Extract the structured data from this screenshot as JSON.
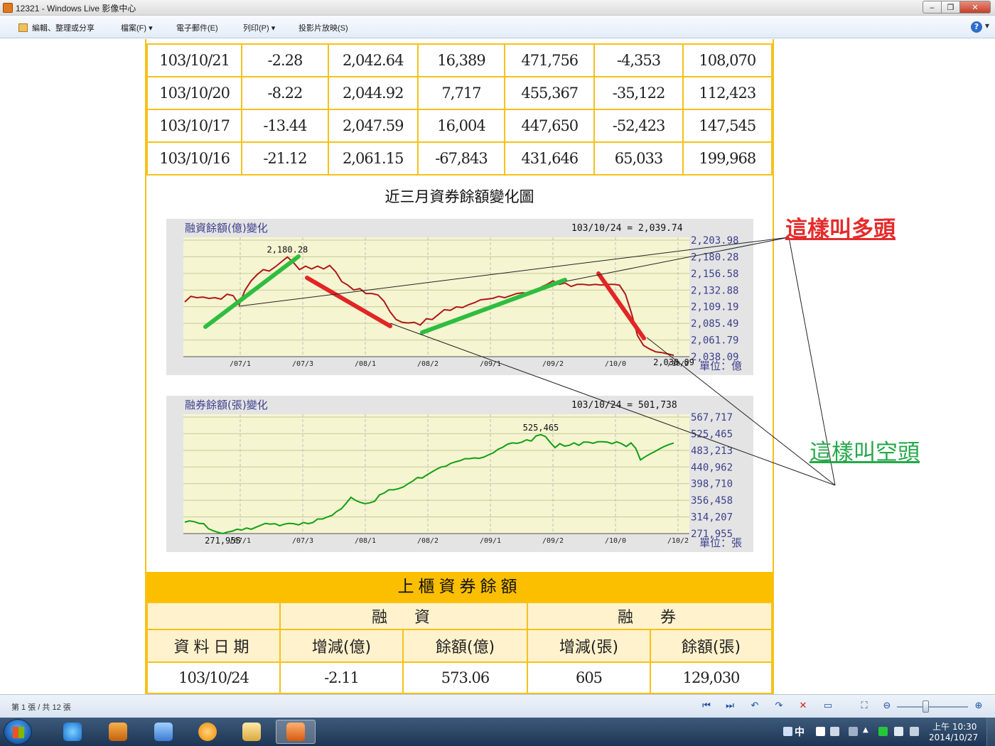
{
  "window": {
    "title": "12321 - Windows Live 影像中心",
    "buttons": {
      "minimize": "‒",
      "maximize": "❐",
      "close": "✕"
    }
  },
  "menu": {
    "edit": "編輯、整理或分享",
    "file": "檔案(F) ▾",
    "email": "電子郵件(E)",
    "print": "列印(P) ▾",
    "slideshow": "投影片放映(S)",
    "help": "?"
  },
  "top_table": {
    "rows": [
      [
        "103/10/21",
        "-2.28",
        "2,042.64",
        "16,389",
        "471,756",
        "-4,353",
        "108,070"
      ],
      [
        "103/10/20",
        "-8.22",
        "2,044.92",
        "7,717",
        "455,367",
        "-35,122",
        "112,423"
      ],
      [
        "103/10/17",
        "-13.44",
        "2,047.59",
        "16,004",
        "447,650",
        "-52,423",
        "147,545"
      ],
      [
        "103/10/16",
        "-21.12",
        "2,061.15",
        "-67,843",
        "431,646",
        "65,033",
        "199,968"
      ]
    ]
  },
  "section_title": "近三月資券餘額變化圖",
  "chart_data": [
    {
      "type": "line",
      "title": "融資餘額(億)變化",
      "latest": "103/10/24 = 2,039.74",
      "unit": "單位：億",
      "x_ticks": [
        "/07/1",
        "/07/3",
        "/08/1",
        "/08/2",
        "/09/1",
        "/09/2",
        "/10/0",
        "/10/2"
      ],
      "y_ticks": [
        "2,203.98",
        "2,180.28",
        "2,156.58",
        "2,132.88",
        "2,109.19",
        "2,085.49",
        "2,061.79",
        "2,038.09"
      ],
      "ylim": [
        2038.09,
        2203.98
      ],
      "max_label": "2,180.28",
      "min_label": "2,038.09",
      "line_color": "#b01818",
      "values": [
        2116,
        2124,
        2122,
        2123,
        2121,
        2122,
        2120,
        2127,
        2125,
        2112,
        2133,
        2146,
        2155,
        2162,
        2160,
        2166,
        2173,
        2180,
        2172,
        2162,
        2167,
        2163,
        2167,
        2163,
        2168,
        2159,
        2145,
        2140,
        2133,
        2135,
        2128,
        2128,
        2126,
        2117,
        2102,
        2091,
        2087,
        2086,
        2087,
        2083,
        2092,
        2091,
        2098,
        2105,
        2104,
        2109,
        2108,
        2112,
        2115,
        2119,
        2120,
        2121,
        2124,
        2122,
        2125,
        2128,
        2129,
        2128,
        2130,
        2137,
        2141,
        2146,
        2141,
        2143,
        2138,
        2141,
        2141,
        2140,
        2141,
        2140,
        2141,
        2141,
        2140,
        2127,
        2100,
        2068,
        2054,
        2049,
        2045,
        2044,
        2042,
        2040
      ]
    },
    {
      "type": "line",
      "title": "融券餘額(張)變化",
      "latest": "103/10/24 = 501,738",
      "unit": "單位：張",
      "x_ticks": [
        "/07/1",
        "/07/3",
        "/08/1",
        "/08/2",
        "/09/1",
        "/09/2",
        "/10/0",
        "/10/2"
      ],
      "y_ticks": [
        "567,717",
        "525,465",
        "483,213",
        "440,962",
        "398,710",
        "356,458",
        "314,207",
        "271,955"
      ],
      "ylim": [
        271955,
        567717
      ],
      "max_label": "525,465",
      "min_label": "271,955",
      "line_color": "#12a012",
      "values": [
        301000,
        304000,
        302000,
        298000,
        297000,
        284000,
        279000,
        275000,
        272000,
        276000,
        278000,
        283000,
        281000,
        286000,
        283000,
        288000,
        293000,
        298000,
        296000,
        297000,
        292000,
        296000,
        298000,
        297000,
        294000,
        300000,
        297000,
        300000,
        309000,
        309000,
        314000,
        318000,
        328000,
        335000,
        349000,
        364000,
        356000,
        351000,
        348000,
        350000,
        354000,
        370000,
        375000,
        383000,
        383000,
        386000,
        390000,
        398000,
        405000,
        414000,
        413000,
        421000,
        428000,
        435000,
        441000,
        443000,
        450000,
        454000,
        457000,
        462000,
        462000,
        464000,
        463000,
        466000,
        472000,
        477000,
        486000,
        491000,
        499000,
        502000,
        501000,
        504000,
        510000,
        507000,
        520000,
        523000,
        518000,
        503000,
        490000,
        500000,
        494000,
        496000,
        502000,
        496000,
        504000,
        504000,
        501000,
        505000,
        505000,
        504000,
        500000,
        505000,
        500000,
        493000,
        502000,
        488000,
        459000,
        467000,
        474000,
        480000,
        487000,
        493000,
        498000,
        501738
      ]
    }
  ],
  "annotations": {
    "bull": "這樣叫多頭",
    "bear": "這樣叫空頭"
  },
  "bottom_table": {
    "caption": "上櫃資券餘額",
    "group_margin": "融　資",
    "group_short": "融　券",
    "headers": [
      "資料日期",
      "增減(億)",
      "餘額(億)",
      "增減(張)",
      "餘額(張)"
    ],
    "row": [
      "103/10/24",
      "-2.11",
      "573.06",
      "605",
      "129,030"
    ]
  },
  "status": {
    "page_info": "第 1 張 / 共 12 張"
  },
  "taskbar": {
    "ime": "中",
    "time": "上午 10:30",
    "date": "2014/10/27"
  },
  "colors": {
    "border": "#f6c11a",
    "header_fill": "#fbbf00",
    "plot_bg": "#f5f5d2",
    "bull_text": "#e52b2b",
    "bear_text": "#26a84a",
    "trend_up": "#2fbd3f",
    "trend_down": "#e12525"
  }
}
